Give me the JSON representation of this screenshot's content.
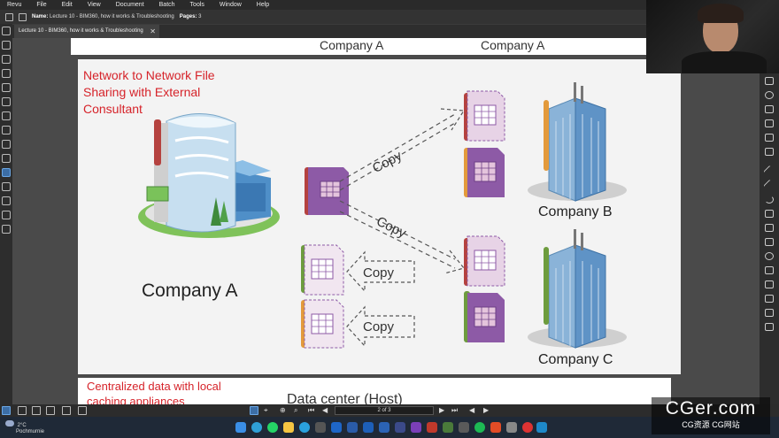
{
  "menu": [
    "Revu",
    "File",
    "Edit",
    "View",
    "Document",
    "Batch",
    "Tools",
    "Window",
    "Help"
  ],
  "info": {
    "name_label": "Name:",
    "name_value": "Lecture 10 - BIM360, how it works & Troubleshooting",
    "pages_label": "Pages:",
    "pages_value": "3"
  },
  "tab": {
    "title": "Lecture 10 - BIM360, how it works & Troubleshooting",
    "close": "✕"
  },
  "page_top": {
    "left_label": "Company A",
    "right_label": "Company A"
  },
  "slide": {
    "title_lines": [
      "Network to Network File",
      "Sharing with External",
      "Consultant"
    ],
    "company_a": "Company A",
    "company_b": "Company B",
    "company_c": "Company C",
    "copy_label": "Copy"
  },
  "page_bottom": {
    "text_lines": [
      "Centralized data with local",
      "caching appliances"
    ],
    "partial_text": "Data center (Host)"
  },
  "nav": {
    "page_field": "2 of 3"
  },
  "weather": {
    "temp": "2°C",
    "condition": "Pochmurnie"
  },
  "watermark": {
    "line1": "CGer.com",
    "line2": "CG资源 CG网站"
  },
  "colors": {
    "red_text": "#d6232a",
    "file_purple": "#8d5aa6",
    "file_pink": "#e4c4dc",
    "strip_red": "#b5423f",
    "strip_orange": "#e39a3c",
    "strip_green": "#6d9c3e",
    "accent_blue": "#3c6ea6"
  }
}
